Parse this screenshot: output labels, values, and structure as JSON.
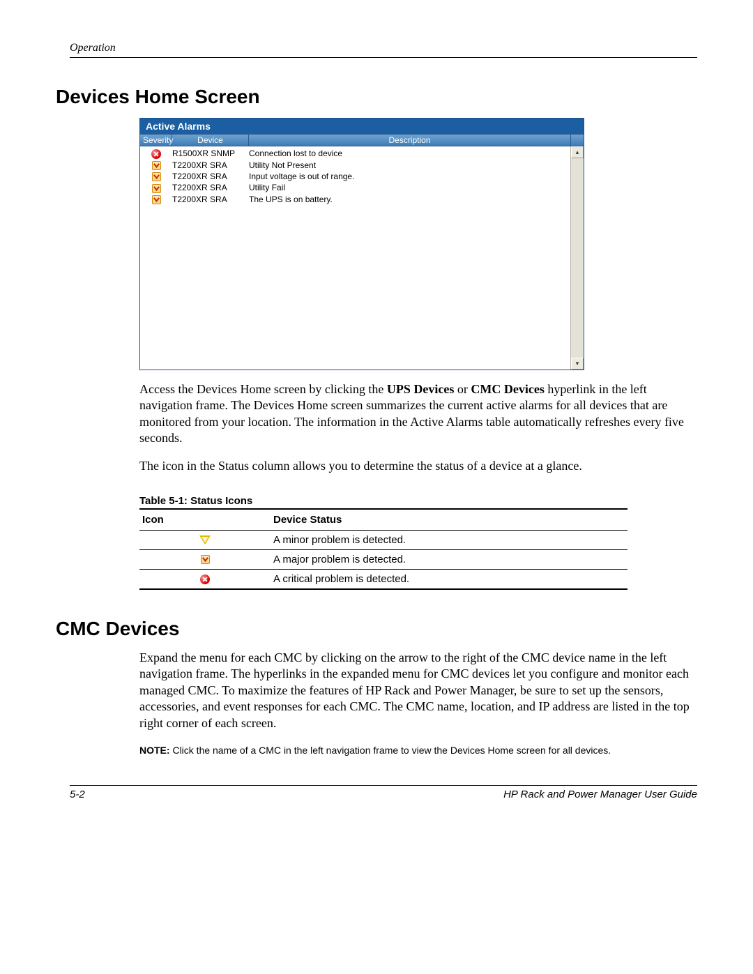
{
  "header": {
    "section": "Operation"
  },
  "headings": {
    "h1a": "Devices Home Screen",
    "h1b": "CMC Devices"
  },
  "alarm_panel": {
    "title": "Active Alarms",
    "columns": {
      "severity": "Severity",
      "device": "Device",
      "description": "Description"
    },
    "rows": [
      {
        "icon": "critical",
        "device": "R1500XR SNMP",
        "description": "Connection lost to device"
      },
      {
        "icon": "major",
        "device": "T2200XR SRA",
        "description": "Utility Not Present"
      },
      {
        "icon": "major",
        "device": "T2200XR SRA",
        "description": "Input voltage is out of range."
      },
      {
        "icon": "major",
        "device": "T2200XR SRA",
        "description": "Utility Fail"
      },
      {
        "icon": "major",
        "device": "T2200XR SRA",
        "description": "The UPS is on battery."
      }
    ]
  },
  "paragraphs": {
    "p1_a": "Access the Devices Home screen by clicking the ",
    "p1_b": "UPS Devices",
    "p1_c": " or ",
    "p1_d": "CMC Devices",
    "p1_e": " hyperlink in the left navigation frame. The Devices Home screen summarizes the current active alarms for all devices that are monitored from your location. The information in the Active Alarms table automatically refreshes every five seconds.",
    "p2": "The icon in the Status column allows you to determine the status of a device at a glance.",
    "p3": "Expand the menu for each CMC by clicking on the arrow to the right of the CMC device name in the left navigation frame. The hyperlinks in the expanded menu for CMC devices let you configure and monitor each managed CMC. To maximize the features of HP Rack and Power Manager, be sure to set up the sensors, accessories, and event responses for each CMC. The CMC name, location, and IP address are listed in the top right corner of each screen."
  },
  "table": {
    "caption": "Table 5-1:  Status Icons",
    "headers": {
      "icon": "Icon",
      "status": "Device Status"
    },
    "rows": [
      {
        "icon": "minor",
        "status": "A minor problem is detected."
      },
      {
        "icon": "major",
        "status": "A major problem is detected."
      },
      {
        "icon": "critical",
        "status": "A critical problem is detected."
      }
    ]
  },
  "note": {
    "label": "NOTE:",
    "text": "  Click the name of a CMC in the left navigation frame to view the Devices Home screen for all devices."
  },
  "footer": {
    "page": "5-2",
    "doc": "HP Rack and Power Manager User Guide"
  }
}
